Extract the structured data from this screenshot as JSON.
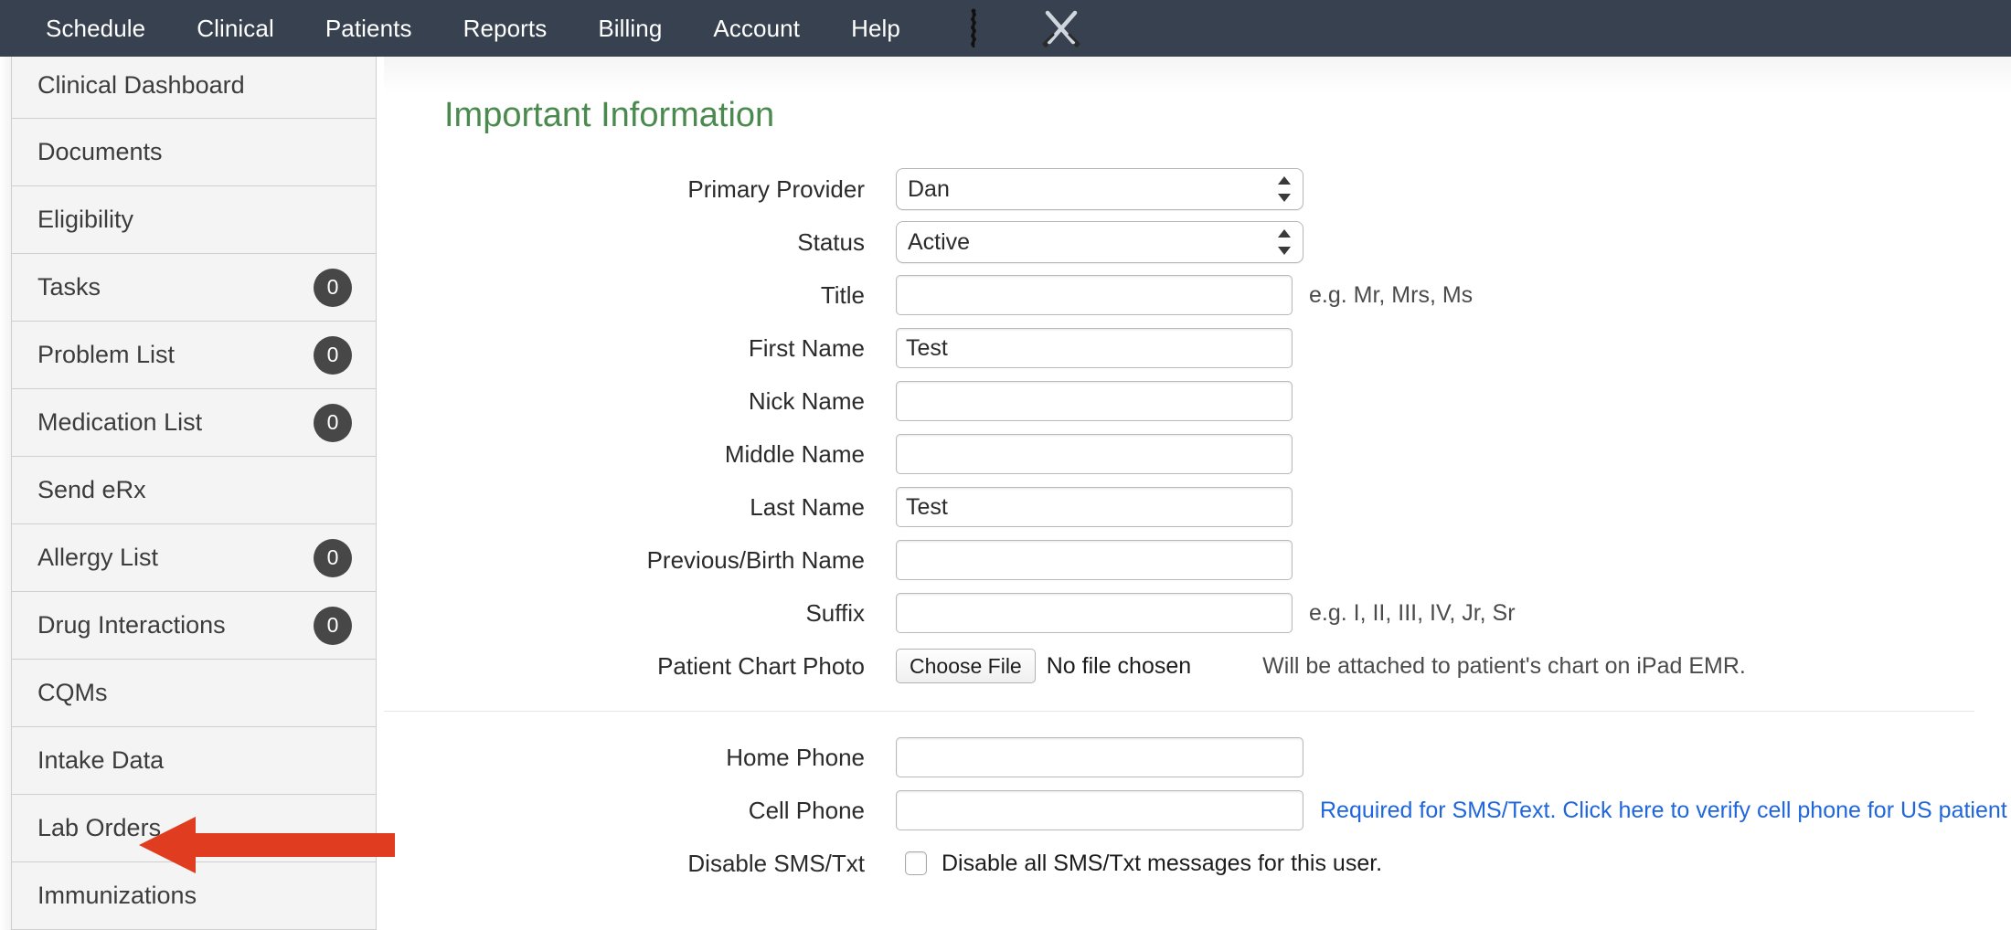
{
  "topnav": {
    "items": [
      {
        "label": "Schedule",
        "name": "nav-schedule"
      },
      {
        "label": "Clinical",
        "name": "nav-clinical"
      },
      {
        "label": "Patients",
        "name": "nav-patients"
      },
      {
        "label": "Reports",
        "name": "nav-reports"
      },
      {
        "label": "Billing",
        "name": "nav-billing"
      },
      {
        "label": "Account",
        "name": "nav-account"
      },
      {
        "label": "Help",
        "name": "nav-help"
      }
    ],
    "icons": [
      {
        "name": "caduceus-icon",
        "glyph": "⚕"
      },
      {
        "name": "crossed-swords-icon",
        "glyph": "⚔"
      }
    ],
    "background": "#38414f",
    "text_color": "#ffffff"
  },
  "sidebar": {
    "items": [
      {
        "label": "Clinical Dashboard",
        "badge": null
      },
      {
        "label": "Documents",
        "badge": null
      },
      {
        "label": "Eligibility",
        "badge": null
      },
      {
        "label": "Tasks",
        "badge": "0"
      },
      {
        "label": "Problem List",
        "badge": "0"
      },
      {
        "label": "Medication List",
        "badge": "0"
      },
      {
        "label": "Send eRx",
        "badge": null
      },
      {
        "label": "Allergy List",
        "badge": "0"
      },
      {
        "label": "Drug Interactions",
        "badge": "0"
      },
      {
        "label": "CQMs",
        "badge": null
      },
      {
        "label": "Intake Data",
        "badge": null
      },
      {
        "label": "Lab Orders",
        "badge": null
      },
      {
        "label": "Immunizations",
        "badge": null
      }
    ],
    "badge_color": "#474747",
    "row_background": "#f4f4f4"
  },
  "callout": {
    "name": "red-arrow-annotation",
    "color": "#e03c1f",
    "points_to": "Lab Orders"
  },
  "main": {
    "section_title": "Important Information",
    "section_title_color": "#4a8a4e",
    "fields": {
      "primary_provider": {
        "label": "Primary Provider",
        "value": "Dan",
        "options": [
          "Dan"
        ]
      },
      "status": {
        "label": "Status",
        "value": "Active",
        "options": [
          "Active"
        ]
      },
      "title": {
        "label": "Title",
        "value": "",
        "placeholder": "",
        "hint": "e.g. Mr, Mrs, Ms"
      },
      "first_name": {
        "label": "First Name",
        "value": "Test",
        "placeholder": ""
      },
      "nick_name": {
        "label": "Nick Name",
        "value": "",
        "placeholder": ""
      },
      "middle_name": {
        "label": "Middle Name",
        "value": "",
        "placeholder": ""
      },
      "last_name": {
        "label": "Last Name",
        "value": "Test",
        "placeholder": ""
      },
      "previous_birth_name": {
        "label": "Previous/Birth Name",
        "value": "",
        "placeholder": ""
      },
      "suffix": {
        "label": "Suffix",
        "value": "",
        "placeholder": "",
        "hint": "e.g. I, II, III, IV, Jr, Sr"
      },
      "patient_chart_photo": {
        "label": "Patient Chart Photo",
        "button": "Choose File",
        "file_status": "No file chosen",
        "hint": "Will be attached to patient's chart on iPad EMR."
      },
      "home_phone": {
        "label": "Home Phone",
        "value": "",
        "placeholder": ""
      },
      "cell_phone": {
        "label": "Cell Phone",
        "value": "",
        "placeholder": "",
        "link": "Required for SMS/Text. Click here to verify cell phone for US patient",
        "link_color": "#1f66dd"
      },
      "disable_sms": {
        "label": "Disable SMS/Txt",
        "checkbox_label": "Disable all SMS/Txt messages for this user.",
        "checked": false
      }
    }
  }
}
